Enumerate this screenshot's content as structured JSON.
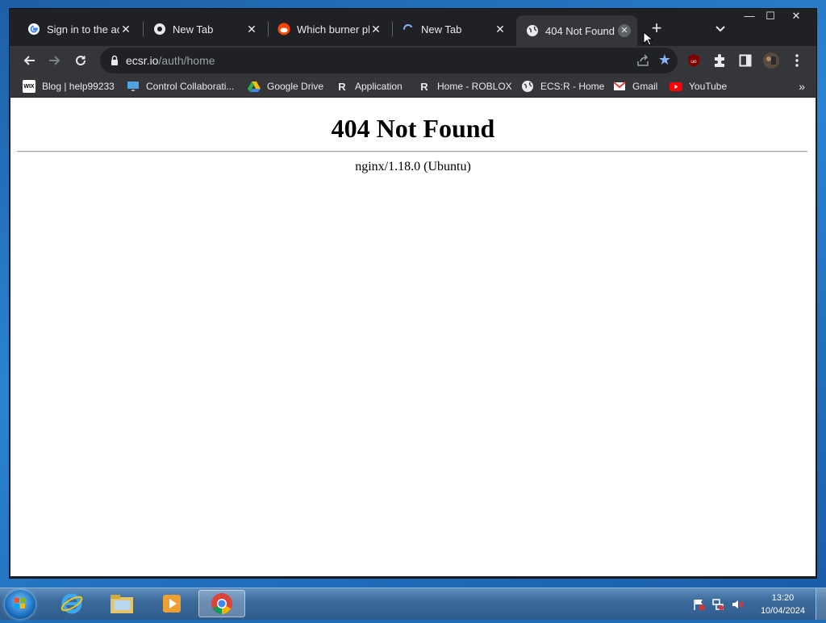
{
  "tabs": [
    {
      "title": "Sign in to the acc",
      "icon": "google-icon"
    },
    {
      "title": "New Tab",
      "icon": "chrome-icon"
    },
    {
      "title": "Which burner ph",
      "icon": "reddit-icon"
    },
    {
      "title": "New Tab",
      "icon": "loading-spinner-icon"
    },
    {
      "title": "404 Not Found",
      "icon": "globe-icon",
      "active": true
    }
  ],
  "tab_close_glyph": "✕",
  "window_controls": {
    "minimize": "—",
    "maximize": "☐",
    "close": "✕"
  },
  "omnibox": {
    "host": "ecsr.io",
    "path": "/auth/home"
  },
  "bookmarks": [
    {
      "label": "Blog | help99233",
      "icon": "wix-icon"
    },
    {
      "label": "Control Collaborati...",
      "icon": "monitor-icon"
    },
    {
      "label": "Google Drive",
      "icon": "google-drive-icon"
    },
    {
      "label": "Application",
      "icon": "roblox-r-icon"
    },
    {
      "label": "Home - ROBLOX",
      "icon": "roblox-r-icon"
    },
    {
      "label": "ECS:R - Home",
      "icon": "globe-icon"
    },
    {
      "label": "Gmail",
      "icon": "gmail-icon"
    },
    {
      "label": "YouTube",
      "icon": "youtube-icon"
    }
  ],
  "page": {
    "heading": "404 Not Found",
    "server": "nginx/1.18.0 (Ubuntu)"
  },
  "taskbar": {
    "time": "13:20",
    "date": "10/04/2024",
    "pinned": [
      "internet-explorer-icon",
      "file-explorer-icon",
      "media-player-icon",
      "chrome-icon"
    ]
  },
  "colors": {
    "chrome_dark": "#202124",
    "chrome_toolbar": "#35363a",
    "star_blue": "#8ab4f8"
  }
}
